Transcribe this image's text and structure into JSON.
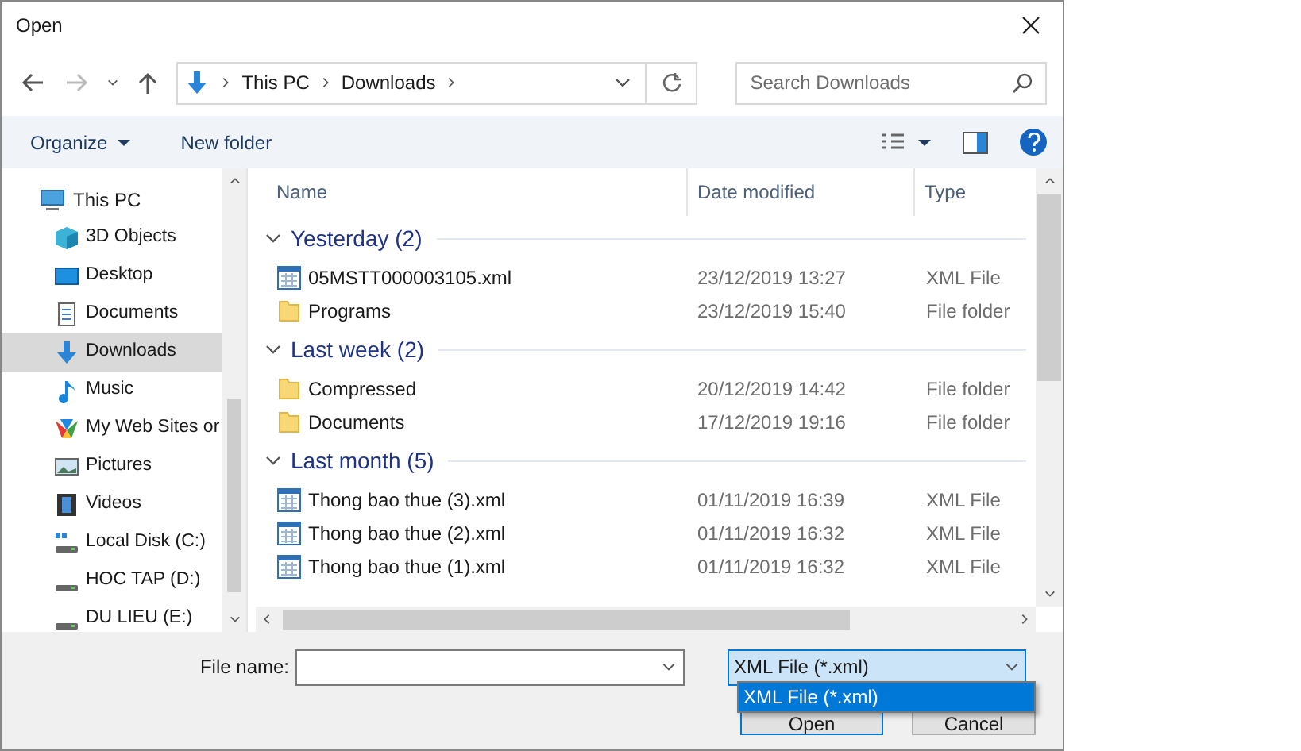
{
  "window": {
    "title": "Open"
  },
  "address": {
    "crumbs": [
      "This PC",
      "Downloads"
    ]
  },
  "search": {
    "placeholder": "Search Downloads"
  },
  "toolbar": {
    "organize": "Organize",
    "new_folder": "New folder"
  },
  "sidebar": {
    "items": [
      {
        "label": "This PC",
        "kind": "pc",
        "selected": false,
        "children": [
          {
            "label": "3D Objects",
            "kind": "cube",
            "selected": false
          },
          {
            "label": "Desktop",
            "kind": "desktop",
            "selected": false
          },
          {
            "label": "Documents",
            "kind": "doc",
            "selected": false
          },
          {
            "label": "Downloads",
            "kind": "download",
            "selected": true
          },
          {
            "label": "Music",
            "kind": "music",
            "selected": false
          },
          {
            "label": "My Web Sites or",
            "kind": "web",
            "selected": false
          },
          {
            "label": "Pictures",
            "kind": "pictures",
            "selected": false
          },
          {
            "label": "Videos",
            "kind": "videos",
            "selected": false
          },
          {
            "label": "Local Disk (C:)",
            "kind": "sysdisk",
            "selected": false
          },
          {
            "label": "HOC TAP (D:)",
            "kind": "disk",
            "selected": false
          },
          {
            "label": "DU LIEU (E:)",
            "kind": "disk",
            "selected": false
          }
        ]
      }
    ]
  },
  "table": {
    "columns": [
      "Name",
      "Date modified",
      "Type"
    ],
    "groups": [
      {
        "title": "Yesterday (2)",
        "expanded": true,
        "rows": [
          {
            "kind": "xml",
            "name": "05MSTT000003105.xml",
            "date": "23/12/2019 13:27",
            "type": "XML File"
          },
          {
            "kind": "folder",
            "name": "Programs",
            "date": "23/12/2019 15:40",
            "type": "File folder"
          }
        ]
      },
      {
        "title": "Last week (2)",
        "expanded": true,
        "rows": [
          {
            "kind": "folder",
            "name": "Compressed",
            "date": "20/12/2019 14:42",
            "type": "File folder"
          },
          {
            "kind": "folder",
            "name": "Documents",
            "date": "17/12/2019 19:16",
            "type": "File folder"
          }
        ]
      },
      {
        "title": "Last month (5)",
        "expanded": true,
        "rows": [
          {
            "kind": "xml",
            "name": "Thong bao thue (3).xml",
            "date": "01/11/2019 16:39",
            "type": "XML File"
          },
          {
            "kind": "xml",
            "name": "Thong bao thue (2).xml",
            "date": "01/11/2019 16:32",
            "type": "XML File"
          },
          {
            "kind": "xml",
            "name": "Thong bao thue (1).xml",
            "date": "01/11/2019 16:32",
            "type": "XML File"
          }
        ]
      }
    ]
  },
  "bottom": {
    "file_name_label": "File name:",
    "file_type": "XML File (*.xml)",
    "dropdown_options": [
      {
        "label": "XML File (*.xml)",
        "selected": true
      }
    ],
    "buttons": [
      "Open",
      "Cancel"
    ]
  }
}
